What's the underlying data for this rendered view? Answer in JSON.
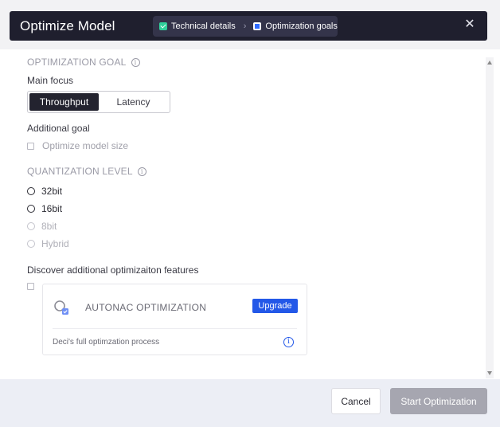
{
  "header": {
    "title": "Optimize Model",
    "steps": [
      {
        "label": "Technical details",
        "state": "completed"
      },
      {
        "label": "Optimization goals",
        "state": "current"
      }
    ],
    "close_glyph": "✕"
  },
  "optimization_goal": {
    "section_title": "OPTIMIZATION GOAL",
    "main_focus_label": "Main focus",
    "focus_options": [
      "Throughput",
      "Latency"
    ],
    "selected_focus": "Throughput",
    "additional_goal_label": "Additional goal",
    "optimize_size_label": "Optimize model size"
  },
  "quantization": {
    "section_title": "QUANTIZATION LEVEL",
    "options": [
      {
        "label": "32bit",
        "enabled": true
      },
      {
        "label": "16bit",
        "enabled": true
      },
      {
        "label": "8bit",
        "enabled": false
      },
      {
        "label": "Hybrid",
        "enabled": false
      }
    ]
  },
  "discover": {
    "label": "Discover additional optimizaiton features",
    "card": {
      "title": "AUTONAC OPTIMIZATION",
      "upgrade_label": "Upgrade",
      "description": "Deci's full optimzation process"
    }
  },
  "footer": {
    "cancel_label": "Cancel",
    "start_label": "Start Optimization"
  },
  "colors": {
    "header_bg": "#1f1f2e",
    "accent_blue": "#2358e8",
    "step_done_green": "#2fd09b",
    "disabled_button": "#a6a6b0"
  }
}
